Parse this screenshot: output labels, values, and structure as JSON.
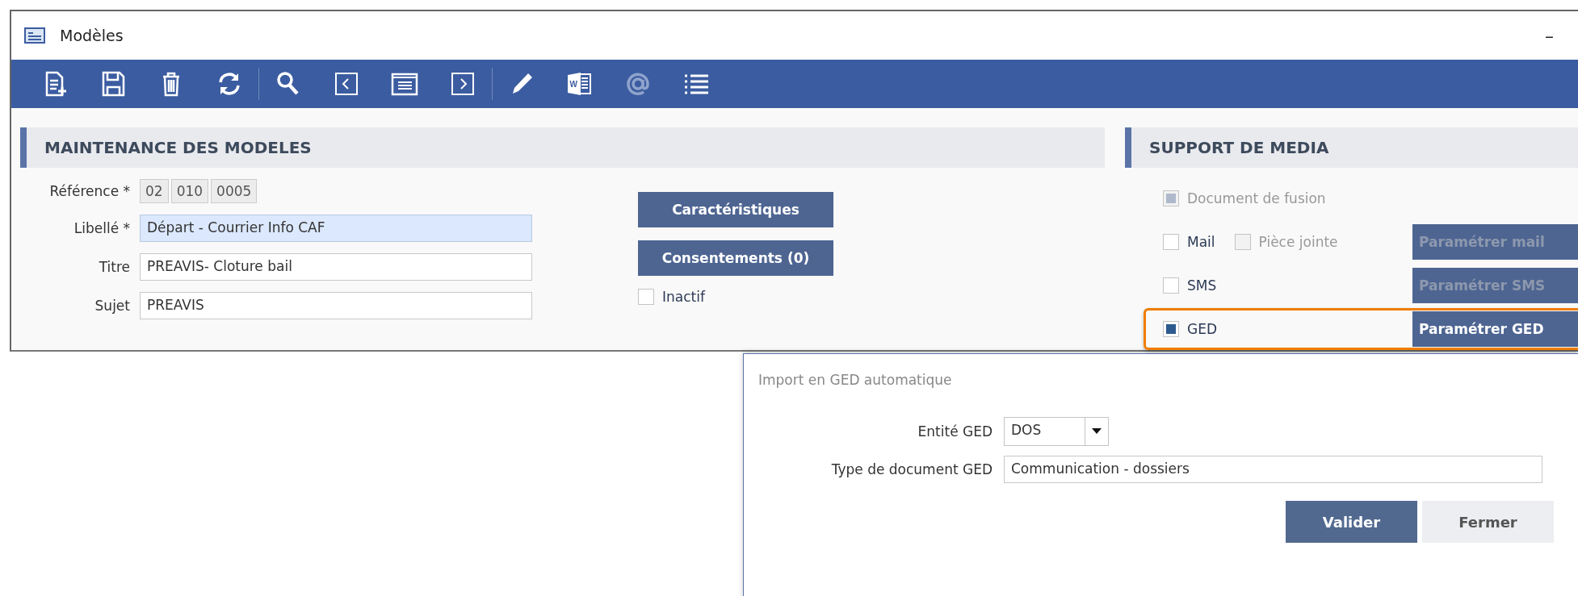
{
  "window": {
    "title": "Modèles",
    "minimize": "–"
  },
  "toolbar": [
    {
      "disabled": false
    },
    {
      "disabled": false
    },
    {
      "disabled": false
    },
    {
      "disabled": false
    },
    {
      "disabled": false
    },
    {
      "disabled": false
    },
    {
      "disabled": false
    },
    {
      "disabled": false
    },
    {
      "disabled": false
    },
    {
      "disabled": false,
      "letter": "W"
    },
    {
      "disabled": true
    },
    {
      "disabled": false
    }
  ],
  "maintenance": {
    "title": "MAINTENANCE DES MODELES",
    "fields": [
      {
        "kind": "reference",
        "label": "Référence *",
        "parts": [
          "02",
          "010",
          "0005"
        ]
      },
      {
        "kind": "text",
        "label": "Libellé *",
        "value": "Départ - Courrier Info CAF",
        "focused": true
      },
      {
        "kind": "text",
        "label": "Titre",
        "value": "PREAVIS- Cloture bail",
        "focused": false
      },
      {
        "kind": "text",
        "label": "Sujet",
        "value": "PREAVIS",
        "focused": false
      }
    ],
    "buttons": [
      "Caractéristiques",
      "Consentements (0)"
    ],
    "inactive": {
      "label": "Inactif",
      "checked": false
    }
  },
  "media": {
    "title": "SUPPORT DE MEDIA",
    "options": [
      {
        "label": "Document de fusion",
        "checked": true,
        "disabled": true,
        "highlighted": false
      },
      {
        "label": "Mail",
        "checked": false,
        "disabled": false,
        "highlighted": false,
        "attachment": {
          "label": "Pièce jointe",
          "checked": false,
          "disabled": true
        },
        "button": {
          "label": "Paramétrer mail",
          "disabled": true
        }
      },
      {
        "label": "SMS",
        "checked": false,
        "disabled": false,
        "highlighted": false,
        "button": {
          "label": "Paramétrer SMS",
          "disabled": true
        }
      },
      {
        "label": "GED",
        "checked": true,
        "disabled": false,
        "highlighted": true,
        "button": {
          "label": "Paramétrer GED",
          "disabled": false
        }
      }
    ]
  },
  "dialog": {
    "title": "Import en GED automatique",
    "entity": {
      "label": "Entité GED",
      "value": "DOS"
    },
    "doc_type": {
      "label": "Type de document GED",
      "value": "Communication - dossiers"
    },
    "buttons": [
      {
        "label": "Valider",
        "primary": true
      },
      {
        "label": "Fermer",
        "primary": false
      }
    ]
  }
}
